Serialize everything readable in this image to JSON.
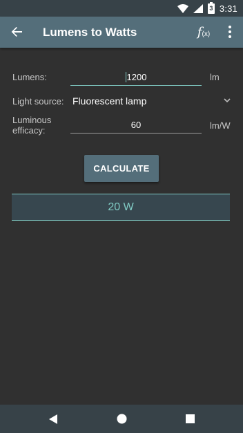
{
  "status_bar": {
    "time": "3:31",
    "battery_level": "3"
  },
  "app_bar": {
    "title": "Lumens to Watts",
    "back_icon": "arrow-back-icon",
    "formula_icon": "function-icon",
    "formula_f": "f",
    "formula_x": "(x)",
    "more_icon": "more-vert-icon",
    "color": "#546e7a"
  },
  "form": {
    "lumens": {
      "label": "Lumens:",
      "value": "1200",
      "unit": "lm"
    },
    "light_source": {
      "label": "Light source:",
      "selected": "Fluorescent lamp"
    },
    "efficacy": {
      "label_line1": "Luminous",
      "label_line2": "efficacy:",
      "value": "60",
      "unit": "lm/W"
    }
  },
  "calculate_button": {
    "label": "CALCULATE"
  },
  "result": {
    "value": "20 W",
    "color": "#80cbc4"
  },
  "nav_bar": {
    "back_icon": "nav-back-icon",
    "home_icon": "nav-home-icon",
    "recents_icon": "nav-recents-icon"
  }
}
